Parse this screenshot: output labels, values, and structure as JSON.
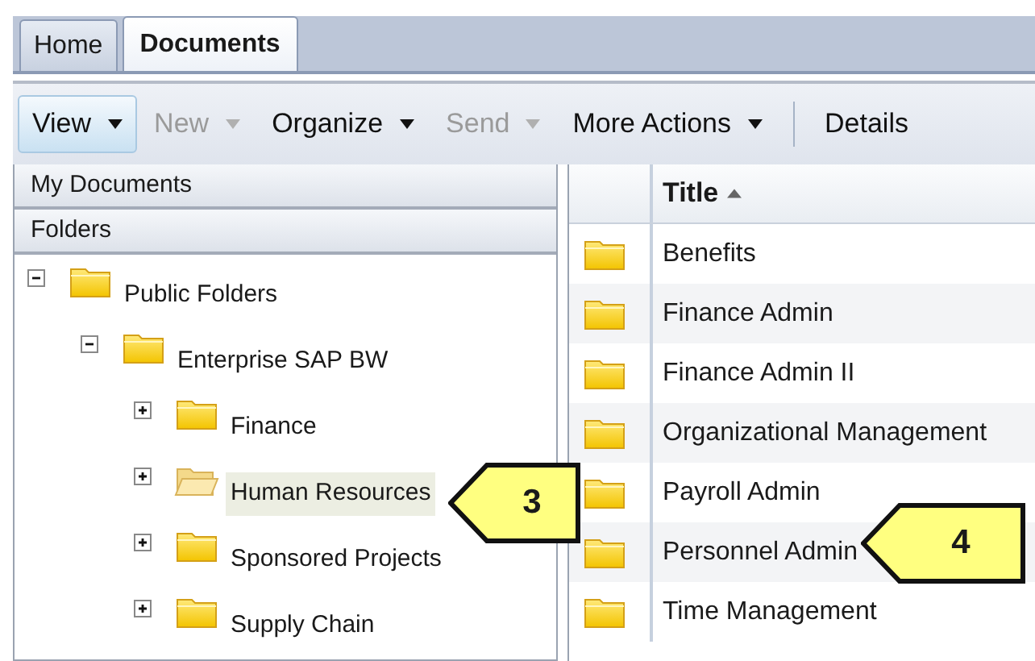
{
  "tabs": [
    {
      "label": "Home",
      "selected": false
    },
    {
      "label": "Documents",
      "selected": true
    }
  ],
  "toolbar": [
    {
      "kind": "menu",
      "label": "View",
      "pressed": true,
      "disabled": false
    },
    {
      "kind": "menu",
      "label": "New",
      "pressed": false,
      "disabled": true
    },
    {
      "kind": "menu",
      "label": "Organize",
      "pressed": false,
      "disabled": false
    },
    {
      "kind": "menu",
      "label": "Send",
      "pressed": false,
      "disabled": true
    },
    {
      "kind": "menu",
      "label": "More Actions",
      "pressed": false,
      "disabled": false
    },
    {
      "kind": "separator"
    },
    {
      "kind": "button",
      "label": "Details",
      "pressed": false,
      "disabled": false
    }
  ],
  "sidebar": {
    "sections": [
      "My Documents",
      "Folders"
    ],
    "tree": [
      {
        "label": "Public Folders",
        "expanded": true,
        "selected": false,
        "children": [
          {
            "label": "Enterprise SAP BW",
            "expanded": true,
            "selected": false,
            "children": [
              {
                "label": "Finance",
                "expanded": false,
                "selected": false
              },
              {
                "label": "Human Resources",
                "expanded": false,
                "selected": true
              },
              {
                "label": "Sponsored Projects",
                "expanded": false,
                "selected": false
              },
              {
                "label": "Supply Chain",
                "expanded": false,
                "selected": false
              }
            ]
          }
        ]
      }
    ]
  },
  "table": {
    "columns": [
      {
        "label": "Title",
        "sorted_ascending": true
      }
    ],
    "rows": [
      {
        "title": "Benefits"
      },
      {
        "title": "Finance Admin"
      },
      {
        "title": "Finance Admin II"
      },
      {
        "title": "Organizational Management"
      },
      {
        "title": "Payroll Admin"
      },
      {
        "title": "Personnel Admin"
      },
      {
        "title": "Time Management"
      }
    ]
  },
  "callouts": [
    {
      "label": "3"
    },
    {
      "label": "4"
    }
  ]
}
